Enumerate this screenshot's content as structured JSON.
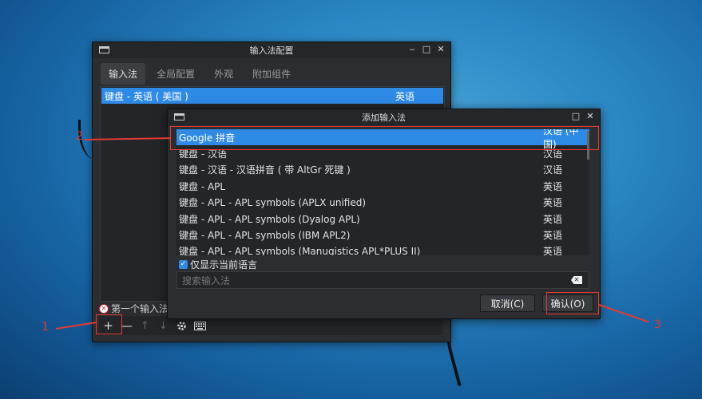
{
  "win1": {
    "title": "输入法配置",
    "btns": [
      "‒",
      "□",
      "✕"
    ],
    "tabs": [
      "输入法",
      "全局配置",
      "外观",
      "附加组件"
    ],
    "row": {
      "name": "键盘 - 英语 ( 美国 )",
      "lang": "英语"
    },
    "hint": "第一个输入法",
    "toolbar": [
      "+",
      "—",
      "↑",
      "↓",
      "gear",
      "keyboard"
    ]
  },
  "win2": {
    "title": "添加输入法",
    "btns": [
      "□",
      "✕"
    ],
    "rows": [
      {
        "name": "Google 拼音",
        "lang": "汉语 (中国)"
      },
      {
        "name": "键盘 - 汉语",
        "lang": "汉语"
      },
      {
        "name": "键盘 - 汉语 - 汉语拼音 ( 带 AltGr 死键 )",
        "lang": "汉语"
      },
      {
        "name": "键盘 - APL",
        "lang": "英语"
      },
      {
        "name": "键盘 - APL - APL symbols (APLX unified)",
        "lang": "英语"
      },
      {
        "name": "键盘 - APL - APL symbols (Dyalog APL)",
        "lang": "英语"
      },
      {
        "name": "键盘 - APL - APL symbols (IBM APL2)",
        "lang": "英语"
      },
      {
        "name": "键盘 - APL - APL symbols (Manugistics APL*PLUS II)",
        "lang": "英语"
      }
    ],
    "checkbox": "仅显示当前语言",
    "search_placeholder": "搜索输入法",
    "cancel": "取消(C)",
    "ok": "确认(O)"
  },
  "callouts": {
    "one": "1",
    "two": "2",
    "three": "3"
  },
  "colors": {
    "accent": "#2f8ae6",
    "annotation": "#e53935"
  }
}
